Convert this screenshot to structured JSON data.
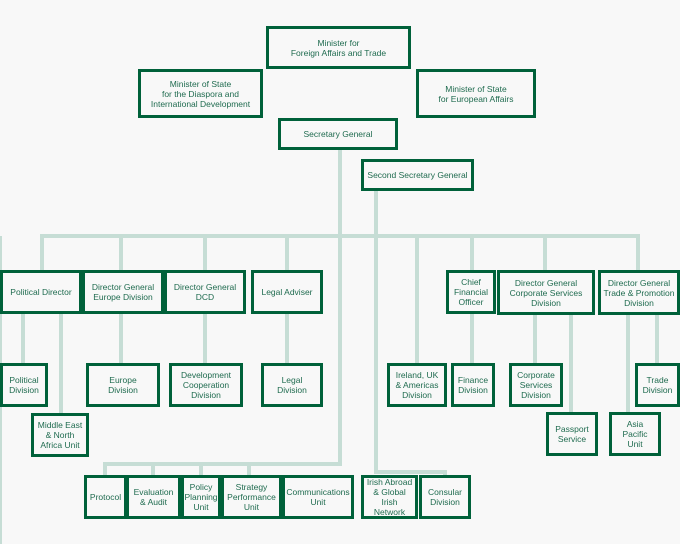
{
  "colors": {
    "box_border": "#00613a",
    "text": "#1f6b4f",
    "connector": "#c6ddd5",
    "background": "#f8f8f8"
  },
  "nodes": {
    "minister": "Minister for\nForeign Affairs and Trade",
    "mos_diaspora": "Minister of State\nfor the Diaspora and\nInternational Development",
    "mos_europe": "Minister of State\nfor European Affairs",
    "secretary_general": "Secretary General",
    "second_secretary_general": "Second Secretary General",
    "political_director": "Political Director",
    "dg_europe": "Director General\nEurope Division",
    "dg_dcd": "Director General\nDCD",
    "legal_adviser": "Legal Adviser",
    "cfo": "Chief\nFinancial\nOfficer",
    "dg_corporate": "Director General\nCorporate Services\nDivision",
    "dg_trade": "Director General\nTrade & Promotion\nDivision",
    "political_division": "Political\nDivision",
    "mena_unit": "Middle East\n& North\nAfrica Unit",
    "europe_division": "Europe\nDivision",
    "dev_coop_division": "Development\nCooperation\nDivision",
    "legal_division": "Legal\nDivision",
    "ireland_uk_americas": "Ireland, UK\n& Americas\nDivision",
    "finance_division": "Finance\nDivision",
    "corporate_services_division": "Corporate\nServices\nDivision",
    "passport_service": "Passport\nService",
    "asia_pacific_unit": "Asia Pacific\nUnit",
    "trade_division": "Trade\nDivision",
    "protocol": "Protocol",
    "evaluation_audit": "Evaluation\n& Audit",
    "policy_planning": "Policy\nPlanning\nUnit",
    "strategy_performance": "Strategy\nPerformance\nUnit",
    "communications_unit": "Communications\nUnit",
    "irish_abroad": "Irish Abroad\n& Global\nIrish Network",
    "consular_division": "Consular\nDivision"
  }
}
